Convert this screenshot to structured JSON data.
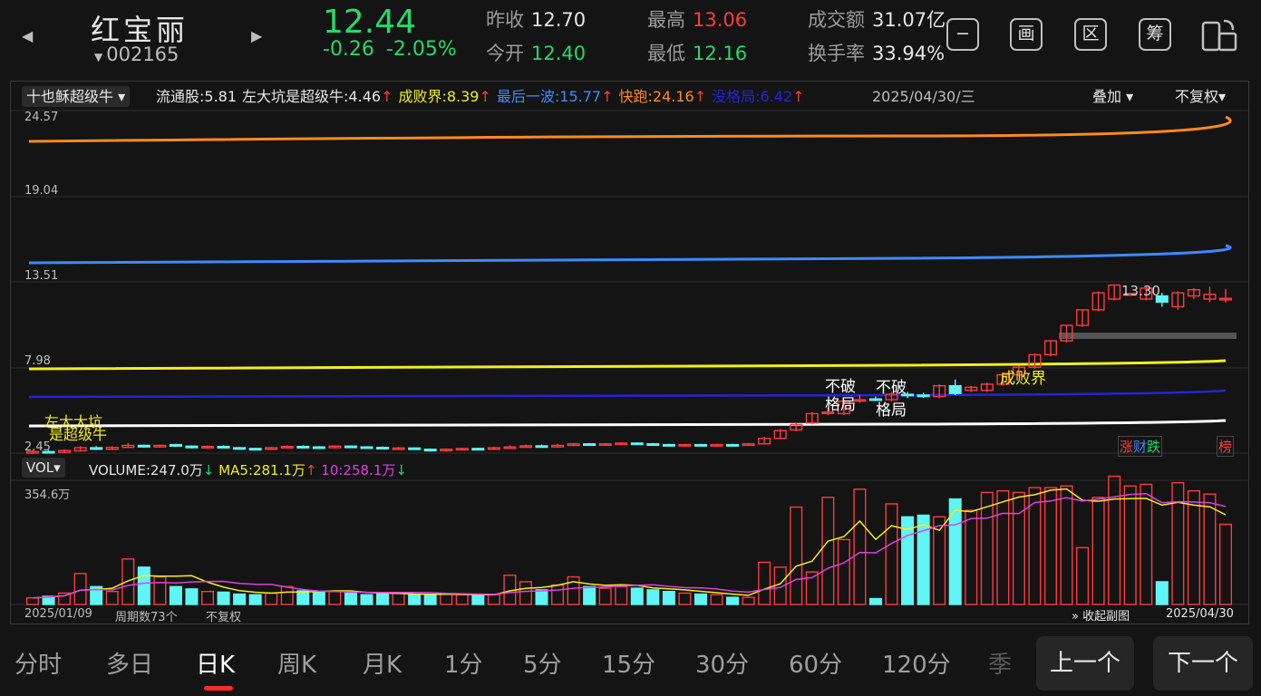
{
  "stock": {
    "name": "红宝丽",
    "code": "002165",
    "price": "12.44",
    "change": "-0.26",
    "change_pct": "-2.05%"
  },
  "quote": {
    "prev_close_label": "昨收",
    "prev_close": "12.70",
    "open_label": "今开",
    "open": "12.40",
    "high_label": "最高",
    "high": "13.06",
    "low_label": "最低",
    "low": "12.16",
    "amount_label": "成交额",
    "amount": "31.07亿",
    "turnover_label": "换手率",
    "turnover": "33.94%"
  },
  "toolbar": {
    "btn1": "−",
    "btn2": "画",
    "btn3": "区",
    "btn4": "筹"
  },
  "indicator": {
    "name": "十也稣超级牛",
    "items": [
      {
        "text": "流通股:5.81",
        "color": "#e6e6e6",
        "arrow": ""
      },
      {
        "text": "左大坑是超级牛:4.46",
        "color": "#e6e6e6",
        "arrow": "↑"
      },
      {
        "text": "成败界:8.39",
        "color": "#f2ee1e",
        "arrow": "↑"
      },
      {
        "text": "最后一波:15.77",
        "color": "#3d8bff",
        "arrow": "↑"
      },
      {
        "text": "快跑:24.16",
        "color": "#ff8a1f",
        "arrow": "↑"
      },
      {
        "text": "没格局:6.42",
        "color": "#2424d8",
        "arrow": "↑"
      }
    ],
    "date": "2025/04/30/三",
    "overlay": "叠加",
    "adjust": "不复权"
  },
  "price_axis": [
    "24.57",
    "19.04",
    "13.51",
    "7.98",
    "2.45"
  ],
  "annotations": {
    "max_label": "13.30",
    "left_pit_1": "左大大坑",
    "left_pit_2": "是超级牛",
    "nopo1a": "不破",
    "nopo1b": "格局",
    "nopo2a": "不破",
    "nopo2b": "格局",
    "success": "成败界",
    "tag_zhang": "涨",
    "tag_cai": "财",
    "tag_die": "跌",
    "tag_bang": "榜"
  },
  "volume": {
    "name": "VOL",
    "volume_label": "VOLUME:247.0万",
    "ma5_label": "MA5:281.1万",
    "ma10_label": "10:258.1万",
    "axis_max": "354.6万",
    "start_date": "2025/01/09",
    "period_count": "周期数73个",
    "adjust": "不复权",
    "collapse": "收起副图",
    "end_date": "2025/04/30"
  },
  "periods": [
    "分时",
    "多日",
    "日K",
    "周K",
    "月K",
    "1分",
    "5分",
    "15分",
    "30分",
    "60分",
    "120分",
    "季"
  ],
  "nav": {
    "prev": "上一个",
    "next": "下一个"
  },
  "colors": {
    "up": "#ff3b3b",
    "down": "#5ff5f5",
    "green": "#26d96b"
  },
  "chart_data": {
    "type": "candlestick",
    "price_ylim": [
      2.45,
      24.57
    ],
    "volume_ylim": [
      0,
      354.6
    ],
    "candles": [
      {
        "o": 2.45,
        "c": 2.55,
        "h": 2.65,
        "l": 2.4,
        "v": 20
      },
      {
        "o": 2.55,
        "c": 2.5,
        "h": 2.65,
        "l": 2.45,
        "v": 25
      },
      {
        "o": 2.5,
        "c": 2.62,
        "h": 2.7,
        "l": 2.45,
        "v": 35
      },
      {
        "o": 2.6,
        "c": 2.8,
        "h": 2.9,
        "l": 2.55,
        "v": 95
      },
      {
        "o": 2.8,
        "c": 2.7,
        "h": 2.9,
        "l": 2.65,
        "v": 55
      },
      {
        "o": 2.7,
        "c": 2.82,
        "h": 2.9,
        "l": 2.65,
        "v": 40
      },
      {
        "o": 2.82,
        "c": 2.95,
        "h": 3.1,
        "l": 2.8,
        "v": 140
      },
      {
        "o": 2.95,
        "c": 2.85,
        "h": 3.0,
        "l": 2.8,
        "v": 115
      },
      {
        "o": 2.85,
        "c": 2.95,
        "h": 3.0,
        "l": 2.8,
        "v": 85
      },
      {
        "o": 3.0,
        "c": 2.9,
        "h": 3.05,
        "l": 2.85,
        "v": 55
      },
      {
        "o": 2.9,
        "c": 2.8,
        "h": 2.95,
        "l": 2.75,
        "v": 48
      },
      {
        "o": 2.8,
        "c": 2.88,
        "h": 2.95,
        "l": 2.75,
        "v": 40
      },
      {
        "o": 2.88,
        "c": 2.8,
        "h": 2.95,
        "l": 2.75,
        "v": 38
      },
      {
        "o": 2.8,
        "c": 2.75,
        "h": 2.85,
        "l": 2.7,
        "v": 32
      },
      {
        "o": 2.75,
        "c": 2.7,
        "h": 2.8,
        "l": 2.65,
        "v": 30
      },
      {
        "o": 2.7,
        "c": 2.8,
        "h": 2.85,
        "l": 2.65,
        "v": 35
      },
      {
        "o": 2.8,
        "c": 2.88,
        "h": 2.95,
        "l": 2.75,
        "v": 55
      },
      {
        "o": 2.88,
        "c": 2.85,
        "h": 2.95,
        "l": 2.8,
        "v": 42
      },
      {
        "o": 2.85,
        "c": 2.8,
        "h": 2.9,
        "l": 2.75,
        "v": 38
      },
      {
        "o": 2.8,
        "c": 2.9,
        "h": 2.95,
        "l": 2.75,
        "v": 40
      },
      {
        "o": 2.9,
        "c": 2.85,
        "h": 2.95,
        "l": 2.8,
        "v": 35
      },
      {
        "o": 2.85,
        "c": 2.82,
        "h": 2.9,
        "l": 2.75,
        "v": 30
      },
      {
        "o": 2.82,
        "c": 2.75,
        "h": 2.88,
        "l": 2.7,
        "v": 32
      },
      {
        "o": 2.75,
        "c": 2.78,
        "h": 2.85,
        "l": 2.7,
        "v": 34
      },
      {
        "o": 2.78,
        "c": 2.7,
        "h": 2.82,
        "l": 2.65,
        "v": 30
      },
      {
        "o": 2.7,
        "c": 2.6,
        "h": 2.75,
        "l": 2.55,
        "v": 30
      },
      {
        "o": 2.6,
        "c": 2.7,
        "h": 2.75,
        "l": 2.55,
        "v": 32
      },
      {
        "o": 2.7,
        "c": 2.75,
        "h": 2.8,
        "l": 2.65,
        "v": 30
      },
      {
        "o": 2.75,
        "c": 2.7,
        "h": 2.8,
        "l": 2.65,
        "v": 28
      },
      {
        "o": 2.7,
        "c": 2.8,
        "h": 2.85,
        "l": 2.65,
        "v": 30
      },
      {
        "o": 2.8,
        "c": 2.85,
        "h": 2.95,
        "l": 2.75,
        "v": 90
      },
      {
        "o": 2.85,
        "c": 2.92,
        "h": 3.0,
        "l": 2.8,
        "v": 70
      },
      {
        "o": 2.92,
        "c": 2.85,
        "h": 3.0,
        "l": 2.8,
        "v": 45
      },
      {
        "o": 2.85,
        "c": 2.95,
        "h": 3.05,
        "l": 2.8,
        "v": 60
      },
      {
        "o": 2.95,
        "c": 3.05,
        "h": 3.1,
        "l": 2.9,
        "v": 85
      },
      {
        "o": 3.05,
        "c": 3.0,
        "h": 3.1,
        "l": 2.95,
        "v": 55
      },
      {
        "o": 3.0,
        "c": 3.05,
        "h": 3.1,
        "l": 2.95,
        "v": 50
      },
      {
        "o": 3.05,
        "c": 3.1,
        "h": 3.15,
        "l": 3.0,
        "v": 55
      },
      {
        "o": 3.1,
        "c": 3.05,
        "h": 3.15,
        "l": 3.0,
        "v": 50
      },
      {
        "o": 3.05,
        "c": 3.0,
        "h": 3.1,
        "l": 2.95,
        "v": 45
      },
      {
        "o": 3.0,
        "c": 2.95,
        "h": 3.05,
        "l": 2.9,
        "v": 40
      },
      {
        "o": 2.95,
        "c": 3.0,
        "h": 3.05,
        "l": 2.9,
        "v": 35
      },
      {
        "o": 3.0,
        "c": 2.95,
        "h": 3.05,
        "l": 2.9,
        "v": 32
      },
      {
        "o": 2.95,
        "c": 3.0,
        "h": 3.05,
        "l": 2.9,
        "v": 30
      },
      {
        "o": 3.0,
        "c": 2.98,
        "h": 3.05,
        "l": 2.95,
        "v": 22
      },
      {
        "o": 2.98,
        "c": 3.05,
        "h": 3.1,
        "l": 2.95,
        "v": 22
      },
      {
        "o": 3.05,
        "c": 3.4,
        "h": 3.5,
        "l": 3.0,
        "v": 130
      },
      {
        "o": 3.4,
        "c": 3.9,
        "h": 4.0,
        "l": 3.35,
        "v": 115
      },
      {
        "o": 3.95,
        "c": 4.3,
        "h": 4.4,
        "l": 3.85,
        "v": 300
      },
      {
        "o": 4.4,
        "c": 5.0,
        "h": 5.1,
        "l": 4.3,
        "v": 100
      },
      {
        "o": 5.1,
        "c": 5.1,
        "h": 5.4,
        "l": 4.9,
        "v": 330
      },
      {
        "o": 5.0,
        "c": 5.8,
        "h": 5.9,
        "l": 4.9,
        "v": 200
      },
      {
        "o": 5.9,
        "c": 5.9,
        "h": 6.2,
        "l": 5.7,
        "v": 355
      },
      {
        "o": 5.95,
        "c": 5.9,
        "h": 6.1,
        "l": 5.8,
        "v": 18
      },
      {
        "o": 5.9,
        "c": 6.25,
        "h": 6.4,
        "l": 5.8,
        "v": 310
      },
      {
        "o": 6.25,
        "c": 6.2,
        "h": 6.4,
        "l": 6.0,
        "v": 270
      },
      {
        "o": 6.2,
        "c": 6.1,
        "h": 6.35,
        "l": 6.0,
        "v": 275
      },
      {
        "o": 6.1,
        "c": 6.8,
        "h": 6.9,
        "l": 6.0,
        "v": 270
      },
      {
        "o": 6.8,
        "c": 6.3,
        "h": 7.2,
        "l": 6.2,
        "v": 325
      },
      {
        "o": 6.5,
        "c": 6.7,
        "h": 6.8,
        "l": 6.4,
        "v": 290
      },
      {
        "o": 6.5,
        "c": 6.9,
        "h": 7.0,
        "l": 6.4,
        "v": 345
      },
      {
        "o": 6.9,
        "c": 7.5,
        "h": 7.6,
        "l": 6.8,
        "v": 350
      },
      {
        "o": 7.5,
        "c": 8.0,
        "h": 8.1,
        "l": 7.4,
        "v": 345
      },
      {
        "o": 8.0,
        "c": 8.8,
        "h": 8.9,
        "l": 7.9,
        "v": 360
      },
      {
        "o": 8.8,
        "c": 9.7,
        "h": 9.7,
        "l": 8.7,
        "v": 360
      },
      {
        "o": 9.7,
        "c": 10.7,
        "h": 10.7,
        "l": 9.6,
        "v": 365
      },
      {
        "o": 10.7,
        "c": 11.7,
        "h": 11.7,
        "l": 10.6,
        "v": 175
      },
      {
        "o": 11.7,
        "c": 12.8,
        "h": 12.9,
        "l": 11.6,
        "v": 330
      },
      {
        "o": 12.4,
        "c": 13.3,
        "h": 13.3,
        "l": 12.3,
        "v": 395
      },
      {
        "o": 12.7,
        "c": 12.75,
        "h": 12.8,
        "l": 12.6,
        "v": 365
      },
      {
        "o": 12.4,
        "c": 13.1,
        "h": 13.2,
        "l": 12.3,
        "v": 370
      },
      {
        "o": 12.6,
        "c": 12.2,
        "h": 12.8,
        "l": 11.9,
        "v": 70
      },
      {
        "o": 11.9,
        "c": 12.8,
        "h": 12.9,
        "l": 11.7,
        "v": 375
      },
      {
        "o": 12.6,
        "c": 13.0,
        "h": 13.1,
        "l": 12.4,
        "v": 350
      },
      {
        "o": 12.4,
        "c": 12.7,
        "h": 13.2,
        "l": 12.2,
        "v": 340
      },
      {
        "o": 12.4,
        "c": 12.44,
        "h": 13.06,
        "l": 12.16,
        "v": 247
      }
    ]
  }
}
